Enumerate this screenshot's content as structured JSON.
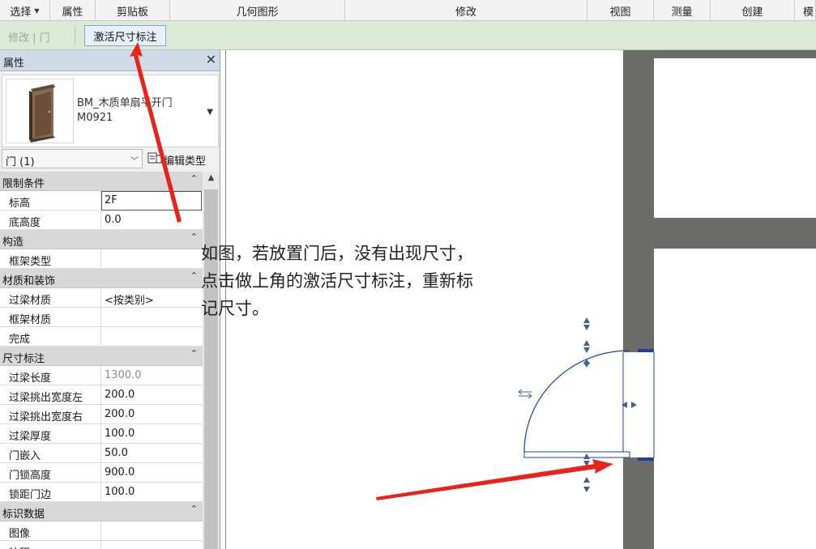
{
  "ribbon": {
    "tabs": [
      {
        "label": "选择",
        "dropdown": true
      },
      {
        "label": "属性"
      },
      {
        "label": "剪贴板"
      },
      {
        "label": "几何图形"
      },
      {
        "label": "修改"
      },
      {
        "label": "视图"
      },
      {
        "label": "测量"
      },
      {
        "label": "创建"
      },
      {
        "label": "模"
      }
    ]
  },
  "context_bar": {
    "modify_label": "修改 | 门",
    "activate_dimensions_label": "激活尺寸标注"
  },
  "properties": {
    "title": "属性",
    "close_glyph": "✕",
    "type_name_line1": "BM_木质单扇平开门",
    "type_name_line2": "M0921",
    "instance_filter": "门 (1)",
    "edit_type_label": "编辑类型",
    "groups": [
      {
        "label": "限制条件",
        "rows": [
          {
            "key": "标高",
            "value": "2F",
            "editing": true
          },
          {
            "key": "底高度",
            "value": "0.0"
          }
        ]
      },
      {
        "label": "构造",
        "rows": [
          {
            "key": "框架类型",
            "value": ""
          }
        ]
      },
      {
        "label": "材质和装饰",
        "rows": [
          {
            "key": "过梁材质",
            "value": "<按类别>"
          },
          {
            "key": "框架材质",
            "value": ""
          },
          {
            "key": "完成",
            "value": ""
          }
        ]
      },
      {
        "label": "尺寸标注",
        "rows": [
          {
            "key": "过梁长度",
            "value": "1300.0",
            "disabled": true
          },
          {
            "key": "过梁挑出宽度左",
            "value": "200.0"
          },
          {
            "key": "过梁挑出宽度右",
            "value": "200.0"
          },
          {
            "key": "过梁厚度",
            "value": "100.0"
          },
          {
            "key": "门嵌入",
            "value": "50.0"
          },
          {
            "key": "门锁高度",
            "value": "900.0"
          },
          {
            "key": "锁距门边",
            "value": "100.0"
          }
        ]
      },
      {
        "label": "标识数据",
        "rows": [
          {
            "key": "图像",
            "value": ""
          },
          {
            "key": "注释",
            "value": ""
          }
        ]
      }
    ]
  },
  "canvas": {
    "annotation_lines": [
      "如图，若放置门后，没有出现尺寸，",
      "点击做上角的激活尺寸标注，重新标",
      "记尺寸。"
    ]
  },
  "colors": {
    "arrow": "#e8231c",
    "wall": "#6b6b68",
    "door_line": "#1c3fa3",
    "context_bar": "#dde9d7",
    "header_blue": "#cfdbe8"
  },
  "icons": {
    "door_thumbnail": "door-thumbnail-icon",
    "edit_type": "edit-type-icon",
    "flip_controls": "flip-arrow-icon"
  }
}
